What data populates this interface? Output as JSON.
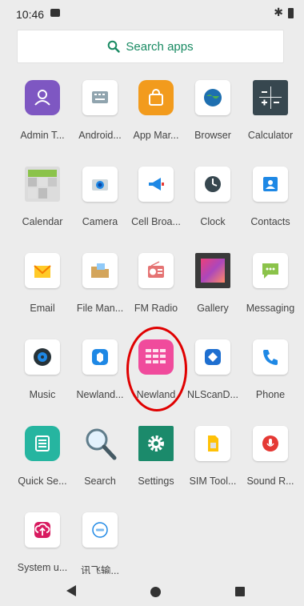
{
  "status_bar": {
    "time": "10:46",
    "bluetooth_icon": "bluetooth-icon",
    "battery_icon": "battery-icon"
  },
  "search": {
    "label": "Search apps",
    "icon": "search-icon",
    "accent": "#188a62"
  },
  "apps": [
    {
      "label": "Admin T...",
      "icon": "admin-tools-icon"
    },
    {
      "label": "Android...",
      "icon": "android-keyboard-icon"
    },
    {
      "label": "App Mar...",
      "icon": "app-market-icon"
    },
    {
      "label": "Browser",
      "icon": "browser-icon"
    },
    {
      "label": "Calculator",
      "icon": "calculator-icon"
    },
    {
      "label": "Calendar",
      "icon": "calendar-icon"
    },
    {
      "label": "Camera",
      "icon": "camera-icon"
    },
    {
      "label": "Cell Broa...",
      "icon": "cell-broadcast-icon"
    },
    {
      "label": "Clock",
      "icon": "clock-icon"
    },
    {
      "label": "Contacts",
      "icon": "contacts-icon"
    },
    {
      "label": "Email",
      "icon": "email-icon"
    },
    {
      "label": "File Man...",
      "icon": "file-manager-icon"
    },
    {
      "label": "FM Radio",
      "icon": "fm-radio-icon"
    },
    {
      "label": "Gallery",
      "icon": "gallery-icon"
    },
    {
      "label": "Messaging",
      "icon": "messaging-icon"
    },
    {
      "label": "Music",
      "icon": "music-icon"
    },
    {
      "label": "Newland...",
      "icon": "newland-app-icon"
    },
    {
      "label": "Newland",
      "icon": "newland-icon"
    },
    {
      "label": "NLScanD...",
      "icon": "nlscan-icon"
    },
    {
      "label": "Phone",
      "icon": "phone-icon"
    },
    {
      "label": "Quick Se...",
      "icon": "quick-settings-icon"
    },
    {
      "label": "Search",
      "icon": "magnifier-icon"
    },
    {
      "label": "Settings",
      "icon": "settings-gear-icon"
    },
    {
      "label": "SIM Tool...",
      "icon": "sim-toolkit-icon"
    },
    {
      "label": "Sound R...",
      "icon": "sound-recorder-icon"
    },
    {
      "label": "System u...",
      "icon": "system-update-icon"
    },
    {
      "label": "讯飞输...",
      "icon": "iflytek-icon"
    }
  ],
  "highlight": {
    "target": "Newland",
    "color": "#e00000"
  },
  "nav": {
    "back": "back-icon",
    "home": "home-icon",
    "recent": "recents-icon"
  }
}
